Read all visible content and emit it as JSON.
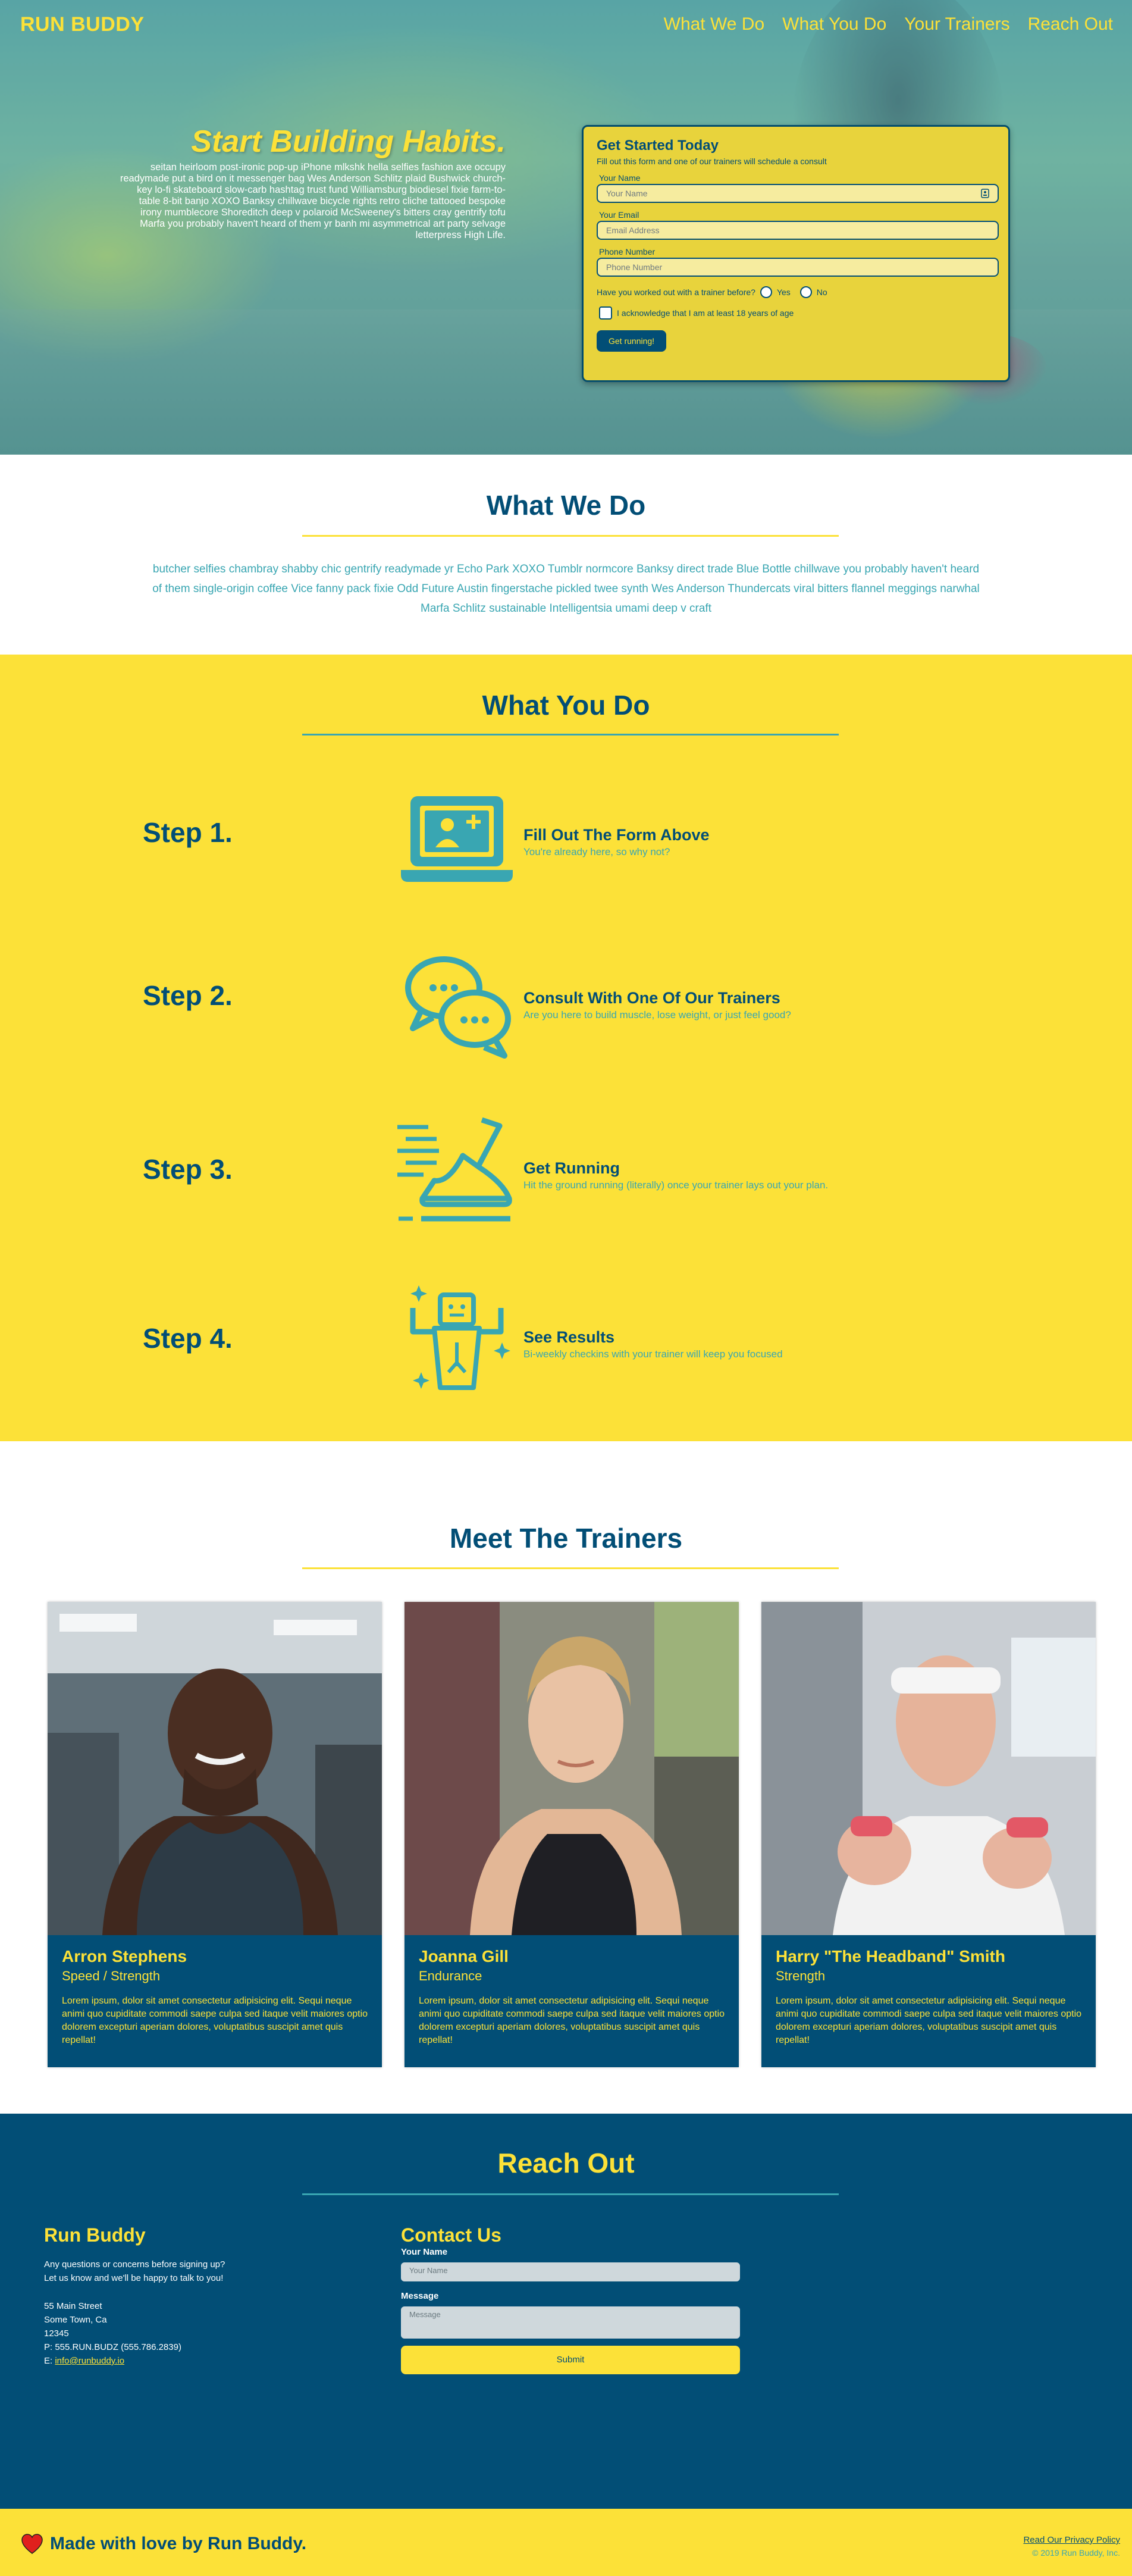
{
  "header": {
    "brand": "RUN BUDDY",
    "nav": [
      "What We Do",
      "What You Do",
      "Your Trainers",
      "Reach Out"
    ]
  },
  "hero": {
    "headline": "Start Building Habits.",
    "body": "seitan heirloom post-ironic pop-up iPhone mlkshk hella selfies fashion axe occupy readymade put a bird on it messenger bag Wes Anderson Schlitz plaid Bushwick church-key lo-fi skateboard slow-carb hashtag trust fund Williamsburg biodiesel fixie farm-to-table 8-bit banjo XOXO Banksy chillwave bicycle rights retro cliche tattooed bespoke irony mumblecore Shoreditch deep v polaroid McSweeney's bitters cray gentrify tofu Marfa you probably haven't heard of them yr banh mi asymmetrical art party selvage letterpress High Life."
  },
  "form": {
    "title": "Get Started Today",
    "subtitle": "Fill out this form and one of our trainers will schedule a consult",
    "name_label": "Your Name",
    "name_placeholder": "Your Name",
    "email_label": "Your Email",
    "email_placeholder": "Email Address",
    "phone_label": "Phone Number",
    "phone_placeholder": "Phone Number",
    "worked_out_question": "Have you worked out with a trainer before?",
    "yes_label": "Yes",
    "no_label": "No",
    "acknowledge_label": "I acknowledge that I am at least 18 years of age",
    "submit_label": "Get running!"
  },
  "what_we_do": {
    "title": "What We Do",
    "text": "butcher selfies chambray shabby chic gentrify readymade yr Echo Park XOXO Tumblr normcore Banksy direct trade Blue Bottle chillwave you probably haven't heard of them single-origin coffee Vice fanny pack fixie Odd Future Austin fingerstache pickled twee synth Wes Anderson Thundercats viral bitters flannel meggings narwhal Marfa Schlitz sustainable Intelligentsia umami deep v craft"
  },
  "what_you_do": {
    "title": "What You Do",
    "steps": [
      {
        "label": "Step 1.",
        "title": "Fill Out The Form Above",
        "desc": "You're already here, so why not?",
        "icon": "laptop-add-user-icon"
      },
      {
        "label": "Step 2.",
        "title": "Consult With One Of Our Trainers",
        "desc": "Are you here to build muscle, lose weight, or just feel good?",
        "icon": "chat-bubbles-icon"
      },
      {
        "label": "Step 3.",
        "title": "Get Running",
        "desc": "Hit the ground running (literally) once your trainer lays out your plan.",
        "icon": "running-shoe-icon"
      },
      {
        "label": "Step 4.",
        "title": "See Results",
        "desc": "Bi-weekly checkins with your trainer will keep you focused",
        "icon": "strong-person-icon"
      }
    ]
  },
  "trainers": {
    "title": "Meet The Trainers",
    "cards": [
      {
        "name": "Arron Stephens",
        "role": "Speed / Strength",
        "bio": "Lorem ipsum, dolor sit amet consectetur adipisicing elit. Sequi neque animi quo cupiditate commodi saepe culpa sed itaque velit maiores optio dolorem excepturi aperiam dolores, voluptatibus suscipit amet quis repellat!"
      },
      {
        "name": "Joanna Gill",
        "role": "Endurance",
        "bio": "Lorem ipsum, dolor sit amet consectetur adipisicing elit. Sequi neque animi quo cupiditate commodi saepe culpa sed itaque velit maiores optio dolorem excepturi aperiam dolores, voluptatibus suscipit amet quis repellat!"
      },
      {
        "name": "Harry \"The Headband\" Smith",
        "role": "Strength",
        "bio": "Lorem ipsum, dolor sit amet consectetur adipisicing elit. Sequi neque animi quo cupiditate commodi saepe culpa sed itaque velit maiores optio dolorem excepturi aperiam dolores, voluptatibus suscipit amet quis repellat!"
      }
    ]
  },
  "reach_out": {
    "title": "Reach Out",
    "brand": "Run Buddy",
    "intro_1": "Any questions or concerns before signing up?",
    "intro_2": "Let us know and we'll be happy to talk to you!",
    "address_1": "55 Main Street",
    "address_2": "Some Town, Ca",
    "address_3": "12345",
    "phone": "P: 555.RUN.BUDZ (555.786.2839)",
    "email_prefix": "E: ",
    "email": "info@runbuddy.io",
    "contact_title": "Contact Us",
    "name_label": "Your Name",
    "name_placeholder": "Your Name",
    "message_label": "Message",
    "message_placeholder": "Message",
    "submit_label": "Submit"
  },
  "footer": {
    "made_with": "Made with love by Run Buddy.",
    "privacy": "Read Our Privacy Policy",
    "copyright": "© 2019 Run Buddy, Inc."
  },
  "colors": {
    "brand_yellow": "#fce138",
    "brand_navy": "#024e76",
    "brand_teal": "#39a6b2"
  }
}
